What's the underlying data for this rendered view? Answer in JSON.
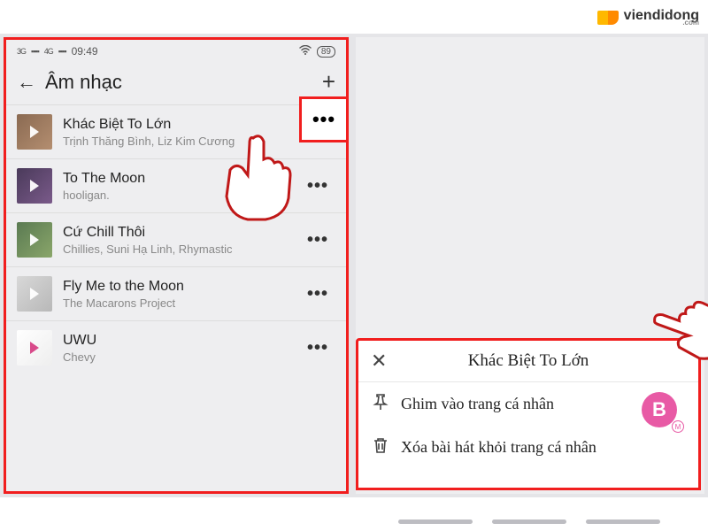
{
  "watermark": {
    "brand": "viendidong",
    "sub": ".com"
  },
  "statusbar": {
    "time": "09:49",
    "net1": "3G",
    "net2": "4G",
    "battery": "89"
  },
  "header": {
    "title": "Âm nhạc"
  },
  "highlight_dots": "•••",
  "songs": [
    {
      "title": "Khác Biệt To Lớn",
      "artist": "Trịnh Thăng Bình, Liz Kim Cương"
    },
    {
      "title": "To The Moon",
      "artist": "hooligan."
    },
    {
      "title": "Cứ Chill Thôi",
      "artist": "Chillies, Suni Hạ Linh, Rhymastic"
    },
    {
      "title": "Fly Me to the Moon",
      "artist": "The Macarons Project"
    },
    {
      "title": "UWU",
      "artist": "Chevy"
    }
  ],
  "sheet": {
    "title": "Khác Biệt To Lớn",
    "pin": "Ghim vào trang cá nhân",
    "delete": "Xóa bài hát khỏi trang cá nhân"
  },
  "badge": {
    "letter": "B",
    "sub": "M"
  }
}
